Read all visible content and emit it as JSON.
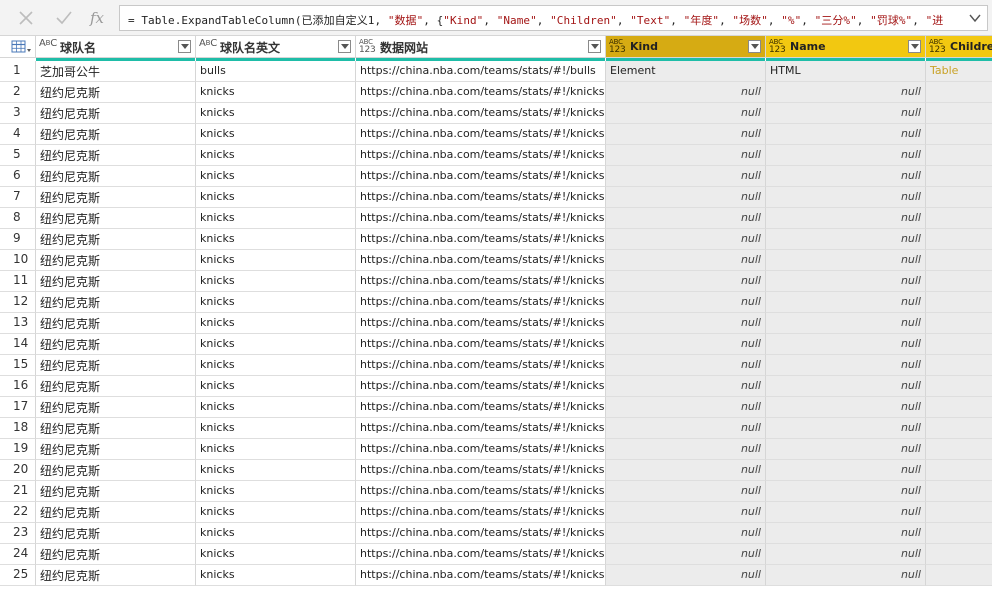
{
  "formula_bar": {
    "cancel_icon": "x-icon",
    "commit_icon": "check-icon",
    "fx_label": "fx",
    "formula_parts": [
      {
        "t": "= Table.ExpandTableColumn(已添加自定义1, ",
        "s": false
      },
      {
        "t": "\"数据\"",
        "s": true
      },
      {
        "t": ", {",
        "s": false
      },
      {
        "t": "\"Kind\"",
        "s": true
      },
      {
        "t": ", ",
        "s": false
      },
      {
        "t": "\"Name\"",
        "s": true
      },
      {
        "t": ", ",
        "s": false
      },
      {
        "t": "\"Children\"",
        "s": true
      },
      {
        "t": ", ",
        "s": false
      },
      {
        "t": "\"Text\"",
        "s": true
      },
      {
        "t": ", ",
        "s": false
      },
      {
        "t": "\"年度\"",
        "s": true
      },
      {
        "t": ", ",
        "s": false
      },
      {
        "t": "\"场数\"",
        "s": true
      },
      {
        "t": ", ",
        "s": false
      },
      {
        "t": "\"%\"",
        "s": true
      },
      {
        "t": ", ",
        "s": false
      },
      {
        "t": "\"三分%\"",
        "s": true
      },
      {
        "t": ", ",
        "s": false
      },
      {
        "t": "\"罚球%\"",
        "s": true
      },
      {
        "t": ", ",
        "s": false
      },
      {
        "t": "\"进",
        "s": true
      }
    ],
    "expand_icon": "chevron-down-icon"
  },
  "table": {
    "corner_icon": "table-menu-icon",
    "columns": [
      {
        "type": "ABC",
        "label": "球队名",
        "style": "plain"
      },
      {
        "type": "ABC",
        "label": "球队名英文",
        "style": "plain"
      },
      {
        "type": "ABC 123",
        "label": "数据网站",
        "style": "plain"
      },
      {
        "type": "ABC 123",
        "label": "Kind",
        "style": "gold"
      },
      {
        "type": "ABC 123",
        "label": "Name",
        "style": "yellow"
      },
      {
        "type": "ABC 123",
        "label": "Children",
        "style": "yellow"
      }
    ],
    "rows": [
      {
        "n": "1",
        "team": "芝加哥公牛",
        "en": "bulls",
        "url": "https://china.nba.com/teams/stats/#!/bulls",
        "kind": "Element",
        "name": "HTML",
        "children": "Table"
      },
      {
        "n": "2",
        "team": "纽约尼克斯",
        "en": "knicks",
        "url": "https://china.nba.com/teams/stats/#!/knicks",
        "kind": "null",
        "name": "null",
        "children": ""
      },
      {
        "n": "3",
        "team": "纽约尼克斯",
        "en": "knicks",
        "url": "https://china.nba.com/teams/stats/#!/knicks",
        "kind": "null",
        "name": "null",
        "children": ""
      },
      {
        "n": "4",
        "team": "纽约尼克斯",
        "en": "knicks",
        "url": "https://china.nba.com/teams/stats/#!/knicks",
        "kind": "null",
        "name": "null",
        "children": ""
      },
      {
        "n": "5",
        "team": "纽约尼克斯",
        "en": "knicks",
        "url": "https://china.nba.com/teams/stats/#!/knicks",
        "kind": "null",
        "name": "null",
        "children": ""
      },
      {
        "n": "6",
        "team": "纽约尼克斯",
        "en": "knicks",
        "url": "https://china.nba.com/teams/stats/#!/knicks",
        "kind": "null",
        "name": "null",
        "children": ""
      },
      {
        "n": "7",
        "team": "纽约尼克斯",
        "en": "knicks",
        "url": "https://china.nba.com/teams/stats/#!/knicks",
        "kind": "null",
        "name": "null",
        "children": ""
      },
      {
        "n": "8",
        "team": "纽约尼克斯",
        "en": "knicks",
        "url": "https://china.nba.com/teams/stats/#!/knicks",
        "kind": "null",
        "name": "null",
        "children": ""
      },
      {
        "n": "9",
        "team": "纽约尼克斯",
        "en": "knicks",
        "url": "https://china.nba.com/teams/stats/#!/knicks",
        "kind": "null",
        "name": "null",
        "children": ""
      },
      {
        "n": "10",
        "team": "纽约尼克斯",
        "en": "knicks",
        "url": "https://china.nba.com/teams/stats/#!/knicks",
        "kind": "null",
        "name": "null",
        "children": ""
      },
      {
        "n": "11",
        "team": "纽约尼克斯",
        "en": "knicks",
        "url": "https://china.nba.com/teams/stats/#!/knicks",
        "kind": "null",
        "name": "null",
        "children": ""
      },
      {
        "n": "12",
        "team": "纽约尼克斯",
        "en": "knicks",
        "url": "https://china.nba.com/teams/stats/#!/knicks",
        "kind": "null",
        "name": "null",
        "children": ""
      },
      {
        "n": "13",
        "team": "纽约尼克斯",
        "en": "knicks",
        "url": "https://china.nba.com/teams/stats/#!/knicks",
        "kind": "null",
        "name": "null",
        "children": ""
      },
      {
        "n": "14",
        "team": "纽约尼克斯",
        "en": "knicks",
        "url": "https://china.nba.com/teams/stats/#!/knicks",
        "kind": "null",
        "name": "null",
        "children": ""
      },
      {
        "n": "15",
        "team": "纽约尼克斯",
        "en": "knicks",
        "url": "https://china.nba.com/teams/stats/#!/knicks",
        "kind": "null",
        "name": "null",
        "children": ""
      },
      {
        "n": "16",
        "team": "纽约尼克斯",
        "en": "knicks",
        "url": "https://china.nba.com/teams/stats/#!/knicks",
        "kind": "null",
        "name": "null",
        "children": ""
      },
      {
        "n": "17",
        "team": "纽约尼克斯",
        "en": "knicks",
        "url": "https://china.nba.com/teams/stats/#!/knicks",
        "kind": "null",
        "name": "null",
        "children": ""
      },
      {
        "n": "18",
        "team": "纽约尼克斯",
        "en": "knicks",
        "url": "https://china.nba.com/teams/stats/#!/knicks",
        "kind": "null",
        "name": "null",
        "children": ""
      },
      {
        "n": "19",
        "team": "纽约尼克斯",
        "en": "knicks",
        "url": "https://china.nba.com/teams/stats/#!/knicks",
        "kind": "null",
        "name": "null",
        "children": ""
      },
      {
        "n": "20",
        "team": "纽约尼克斯",
        "en": "knicks",
        "url": "https://china.nba.com/teams/stats/#!/knicks",
        "kind": "null",
        "name": "null",
        "children": ""
      },
      {
        "n": "21",
        "team": "纽约尼克斯",
        "en": "knicks",
        "url": "https://china.nba.com/teams/stats/#!/knicks",
        "kind": "null",
        "name": "null",
        "children": ""
      },
      {
        "n": "22",
        "team": "纽约尼克斯",
        "en": "knicks",
        "url": "https://china.nba.com/teams/stats/#!/knicks",
        "kind": "null",
        "name": "null",
        "children": ""
      },
      {
        "n": "23",
        "team": "纽约尼克斯",
        "en": "knicks",
        "url": "https://china.nba.com/teams/stats/#!/knicks",
        "kind": "null",
        "name": "null",
        "children": ""
      },
      {
        "n": "24",
        "team": "纽约尼克斯",
        "en": "knicks",
        "url": "https://china.nba.com/teams/stats/#!/knicks",
        "kind": "null",
        "name": "null",
        "children": ""
      },
      {
        "n": "25",
        "team": "纽约尼克斯",
        "en": "knicks",
        "url": "https://china.nba.com/teams/stats/#!/knicks",
        "kind": "null",
        "name": "null",
        "children": ""
      }
    ]
  },
  "colors": {
    "accent_gold": "#d6ab13",
    "accent_yellow": "#f2c811",
    "quality_bar": "#1fbda8",
    "string_literal": "#a31515"
  }
}
